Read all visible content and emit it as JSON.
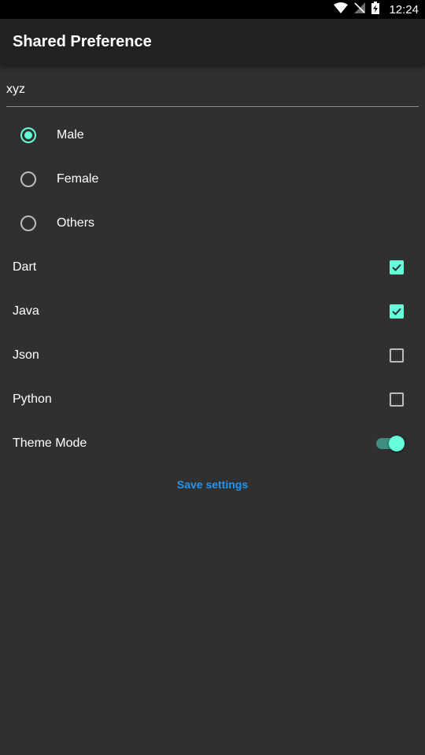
{
  "status_bar": {
    "time": "12:24",
    "icons": [
      "wifi-icon",
      "no-signal-icon",
      "battery-charging-icon"
    ]
  },
  "app_bar": {
    "title": "Shared Preference"
  },
  "text_field": {
    "value": "xyz"
  },
  "gender": {
    "options": [
      {
        "label": "Male",
        "selected": true
      },
      {
        "label": "Female",
        "selected": false
      },
      {
        "label": "Others",
        "selected": false
      }
    ]
  },
  "languages": {
    "items": [
      {
        "label": "Dart",
        "checked": true
      },
      {
        "label": "Java",
        "checked": true
      },
      {
        "label": "Json",
        "checked": false
      },
      {
        "label": "Python",
        "checked": false
      }
    ]
  },
  "theme_mode": {
    "label": "Theme Mode",
    "enabled": true
  },
  "save_button": {
    "label": "Save settings"
  },
  "colors": {
    "accent": "#64ffda",
    "button_text": "#2196f3",
    "background": "#303030",
    "app_bar": "#212121"
  }
}
